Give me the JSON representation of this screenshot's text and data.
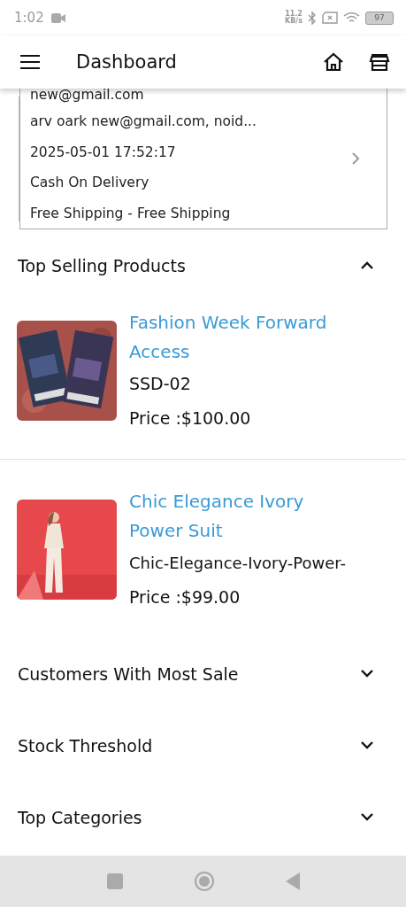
{
  "status_bar": {
    "time": "1:02",
    "speed_value": "11.2",
    "speed_unit": "KB/s",
    "battery": "97"
  },
  "app_bar": {
    "title": "Dashboard"
  },
  "order_card": {
    "lines": [
      "new@gmail.com",
      "arv oark new@gmail.com, noid...",
      "2025-05-01 17:52:17",
      "Cash On Delivery",
      "Free Shipping - Free Shipping"
    ]
  },
  "sections": [
    {
      "title": "Top Selling Products",
      "expanded": true,
      "products": [
        {
          "name": "Fashion Week Forward Access",
          "sku": "SSD-02",
          "price": "Price :$100.00"
        },
        {
          "name": "Chic Elegance Ivory Power Suit",
          "sku": "Chic-Elegance-Ivory-Power-",
          "price": "Price :$99.00"
        }
      ]
    },
    {
      "title": "Customers With Most Sale",
      "expanded": false
    },
    {
      "title": "Stock Threshold",
      "expanded": false
    },
    {
      "title": "Top Categories",
      "expanded": false
    }
  ]
}
